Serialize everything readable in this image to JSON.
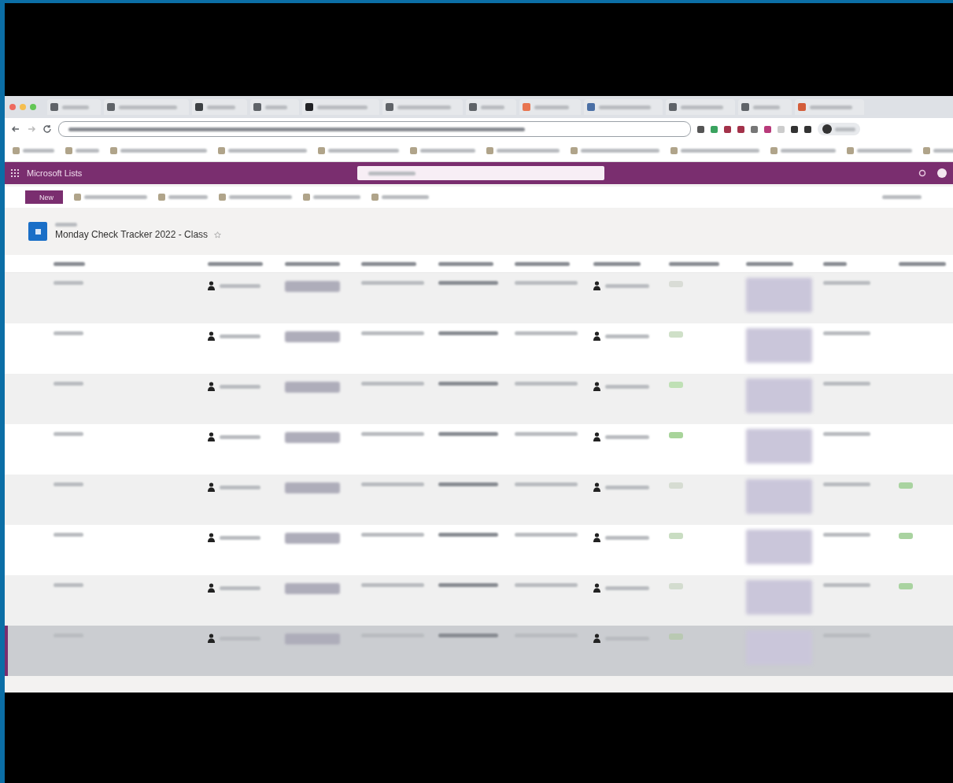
{
  "app_bar": {
    "title": "Microsoft Lists"
  },
  "command_bar": {
    "new_button": "New"
  },
  "list": {
    "title": "Monday Check Tracker 2022 - Class"
  },
  "rows": [
    {
      "selected": false,
      "color": "#d9dcd6",
      "approved": false
    },
    {
      "selected": false,
      "color": "#cfe0c8",
      "approved": false
    },
    {
      "selected": false,
      "color": "#bfe0b5",
      "approved": false
    },
    {
      "selected": false,
      "color": "#a8d49a",
      "approved": false
    },
    {
      "selected": false,
      "color": "#d6dcd2",
      "approved": true
    },
    {
      "selected": false,
      "color": "#c9ddc2",
      "approved": true
    },
    {
      "selected": false,
      "color": "#d3dccf",
      "approved": true
    },
    {
      "selected": true,
      "color": "#b9c9b2",
      "approved": false
    }
  ]
}
